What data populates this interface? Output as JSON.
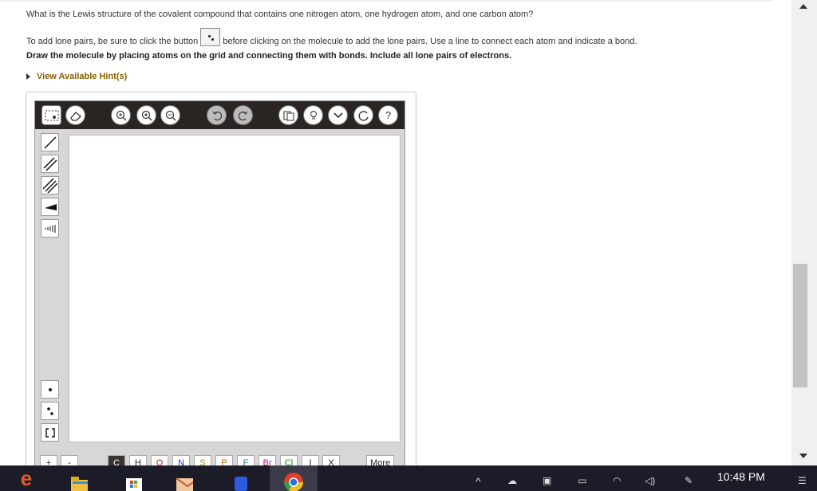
{
  "question": "What is the Lewis structure of the covalent compound that contains one nitrogen atom, one hydrogen atom, and one carbon atom?",
  "instructions": {
    "before": "To add lone pairs, be sure to click the button",
    "after": "before clicking on the molecule to add the lone pairs. Use a line to connect each atom and indicate a bond."
  },
  "bold_instruction": "Draw the molecule by placing atoms on the grid and connecting them with bonds. Include all lone pairs of electrons.",
  "hint_link": "View Available Hint(s)",
  "toolbar": {
    "buttons": [
      "select-icon",
      "eraser-icon",
      "zoom-in-icon",
      "zoom-fit-icon",
      "zoom-out-icon",
      "undo-icon",
      "redo-icon",
      "template-icon",
      "lightbulb-icon",
      "chevron-down-icon",
      "refresh-icon",
      "help-icon"
    ],
    "help_label": "?"
  },
  "side_tools": [
    "single-bond-icon",
    "double-bond-icon",
    "triple-bond-icon",
    "wedge-bond-icon",
    "hash-bond-icon",
    "one-electron-icon",
    "lone-pair-icon",
    "bracket-icon"
  ],
  "elements": [
    "+",
    "-",
    "C",
    "H",
    "O",
    "N",
    "S",
    "P",
    "F",
    "Br",
    "Cl",
    "I",
    "X"
  ],
  "more_label": "More",
  "clock": "10:48 PM",
  "colors": {
    "hint": "#8a6000",
    "toolbar_bg": "#2a2422",
    "taskbar_bg": "#1c1c28",
    "N": "#1a3ccc",
    "O": "#cc1a1a",
    "Br": "#a01a6a",
    "Cl": "#1a8a1a",
    "S": "#9a8a1a",
    "P": "#c06010",
    "F": "#1a8a8a"
  }
}
